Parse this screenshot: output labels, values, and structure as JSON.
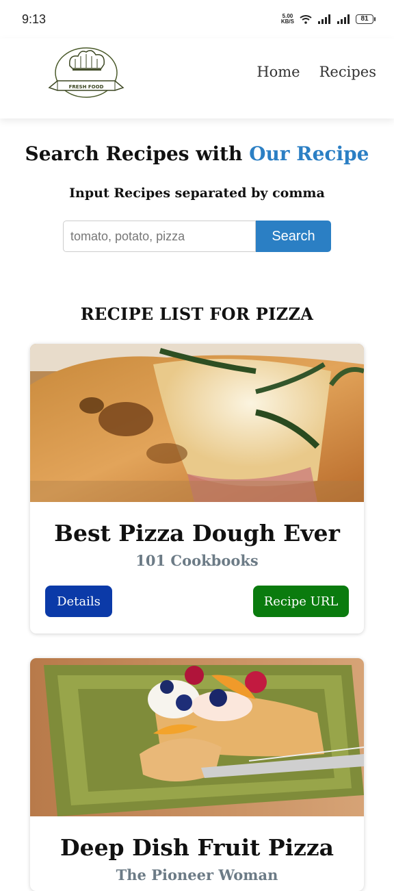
{
  "status_bar": {
    "time": "9:13",
    "net_speed_value": "5.00",
    "net_speed_unit": "KB/S",
    "battery": "81"
  },
  "navbar": {
    "logo_text": "FRESH FOOD",
    "links": [
      {
        "label": "Home"
      },
      {
        "label": "Recipes"
      }
    ]
  },
  "search": {
    "title_prefix": "Search Recipes with ",
    "title_accent": "Our Recipe",
    "subtitle": "Input Recipes separated by comma",
    "placeholder": "tomato, potato, pizza",
    "button_label": "Search"
  },
  "results": {
    "heading": "RECIPE LIST FOR PIZZA",
    "cards": [
      {
        "title": "Best Pizza Dough Ever",
        "source": "101 Cookbooks",
        "details_label": "Details",
        "url_label": "Recipe URL"
      },
      {
        "title": "Deep Dish Fruit Pizza",
        "source": "The Pioneer Woman"
      }
    ]
  },
  "colors": {
    "accent": "#2b7fc4",
    "details_button": "#0b3aa8",
    "url_button": "#0a7b0e"
  }
}
